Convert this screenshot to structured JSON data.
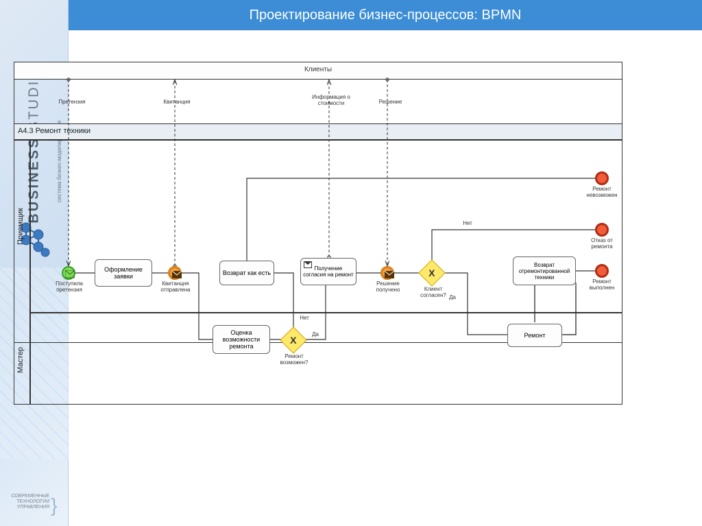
{
  "sidebar": {
    "brand_bold": "BUSINESS",
    "brand_light": "STUDIO",
    "tagline": "система бизнес-моделирования",
    "footer_line1": "СОВРЕМЕННЫЕ",
    "footer_line2": "ТЕХНОЛОГИИ",
    "footer_line3": "УПРАВЛЕНИЯ"
  },
  "title": "Проектирование бизнес-процессов: BPMN",
  "diagram": {
    "externalPool": "Клиенты",
    "poolTitle": "A4.3 Ремонт техники",
    "lanes": {
      "top": "Приемщик",
      "bottom": "Мастер"
    },
    "messageFlows": {
      "m1": "Претензия",
      "m2": "Квитанция",
      "m3": "Информация о стоимости",
      "m4": "Решение"
    },
    "events": {
      "start": "Поступила претензия",
      "msg1": "Квитанция отправлена",
      "msg2": "Решение получено",
      "end1": "Ремонт невозможен",
      "end2": "Отказ от ремонта",
      "end3": "Ремонт выполнен"
    },
    "tasks": {
      "t1": "Оформление заявки",
      "t2": "Возврат как есть",
      "t3": "Получение согласия на ремонт",
      "t4": "Возврат отремонтированной техники",
      "t5": "Оценка возможности ремонта",
      "t6": "Ремонт"
    },
    "gateways": {
      "g1": "Ремонт возможен?",
      "g2": "Клиент согласен?"
    },
    "branches": {
      "yes": "Да",
      "no": "Нет"
    }
  }
}
